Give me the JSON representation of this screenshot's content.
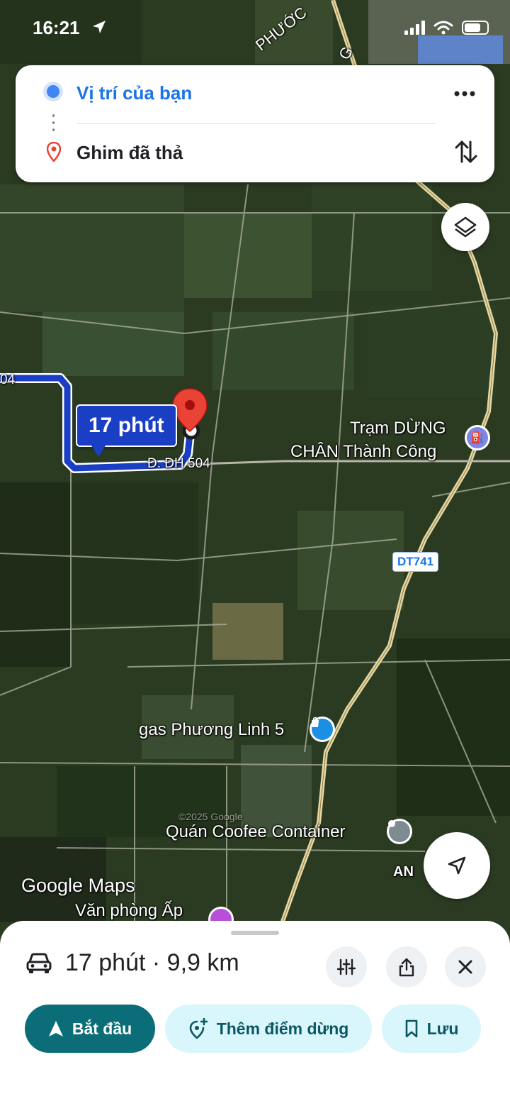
{
  "status_bar": {
    "time": "16:21"
  },
  "route_card": {
    "origin": "Vị trí của bạn",
    "destination": "Ghim đã thả"
  },
  "map": {
    "road_label_top": "PHƯỚC",
    "road_label_top2": "G",
    "road_label_left": "04",
    "road_label_dh504": "Đ. ĐH 504",
    "highway_shield": "DT741",
    "route_eta": "17 phút",
    "poi_tram": "Trạm DỪNG CHÂN Thành Công",
    "poi_tram_line1": "Trạm DỪNG",
    "poi_tram_line2": "CHÂN Thành Công",
    "poi_gas": "gas Phương Linh 5",
    "poi_coffee": "Quán Coofee Container",
    "poi_office": "Văn phòng Ấp",
    "place_an": "AN",
    "watermark": "©2025 Google",
    "logo": "Google Maps"
  },
  "bottom_sheet": {
    "summary": "17 phút · 9,9 km",
    "start_label": "Bắt đầu",
    "add_stop_label": "Thêm điểm dừng",
    "save_label": "Lưu"
  },
  "colors": {
    "route_blue": "#1a3fc4",
    "primary_teal": "#0b6d77",
    "pill_light": "#d8f6fb",
    "origin_blue": "#4285f4",
    "pin_red": "#ea4335"
  },
  "icons": [
    "location-arrow-icon",
    "signal-icon",
    "wifi-icon",
    "battery-icon",
    "more-icon",
    "swap-icon",
    "layers-icon",
    "navigate-icon",
    "car-icon",
    "options-icon",
    "share-icon",
    "close-icon",
    "start-arrow-icon",
    "add-stop-icon",
    "bookmark-icon"
  ]
}
